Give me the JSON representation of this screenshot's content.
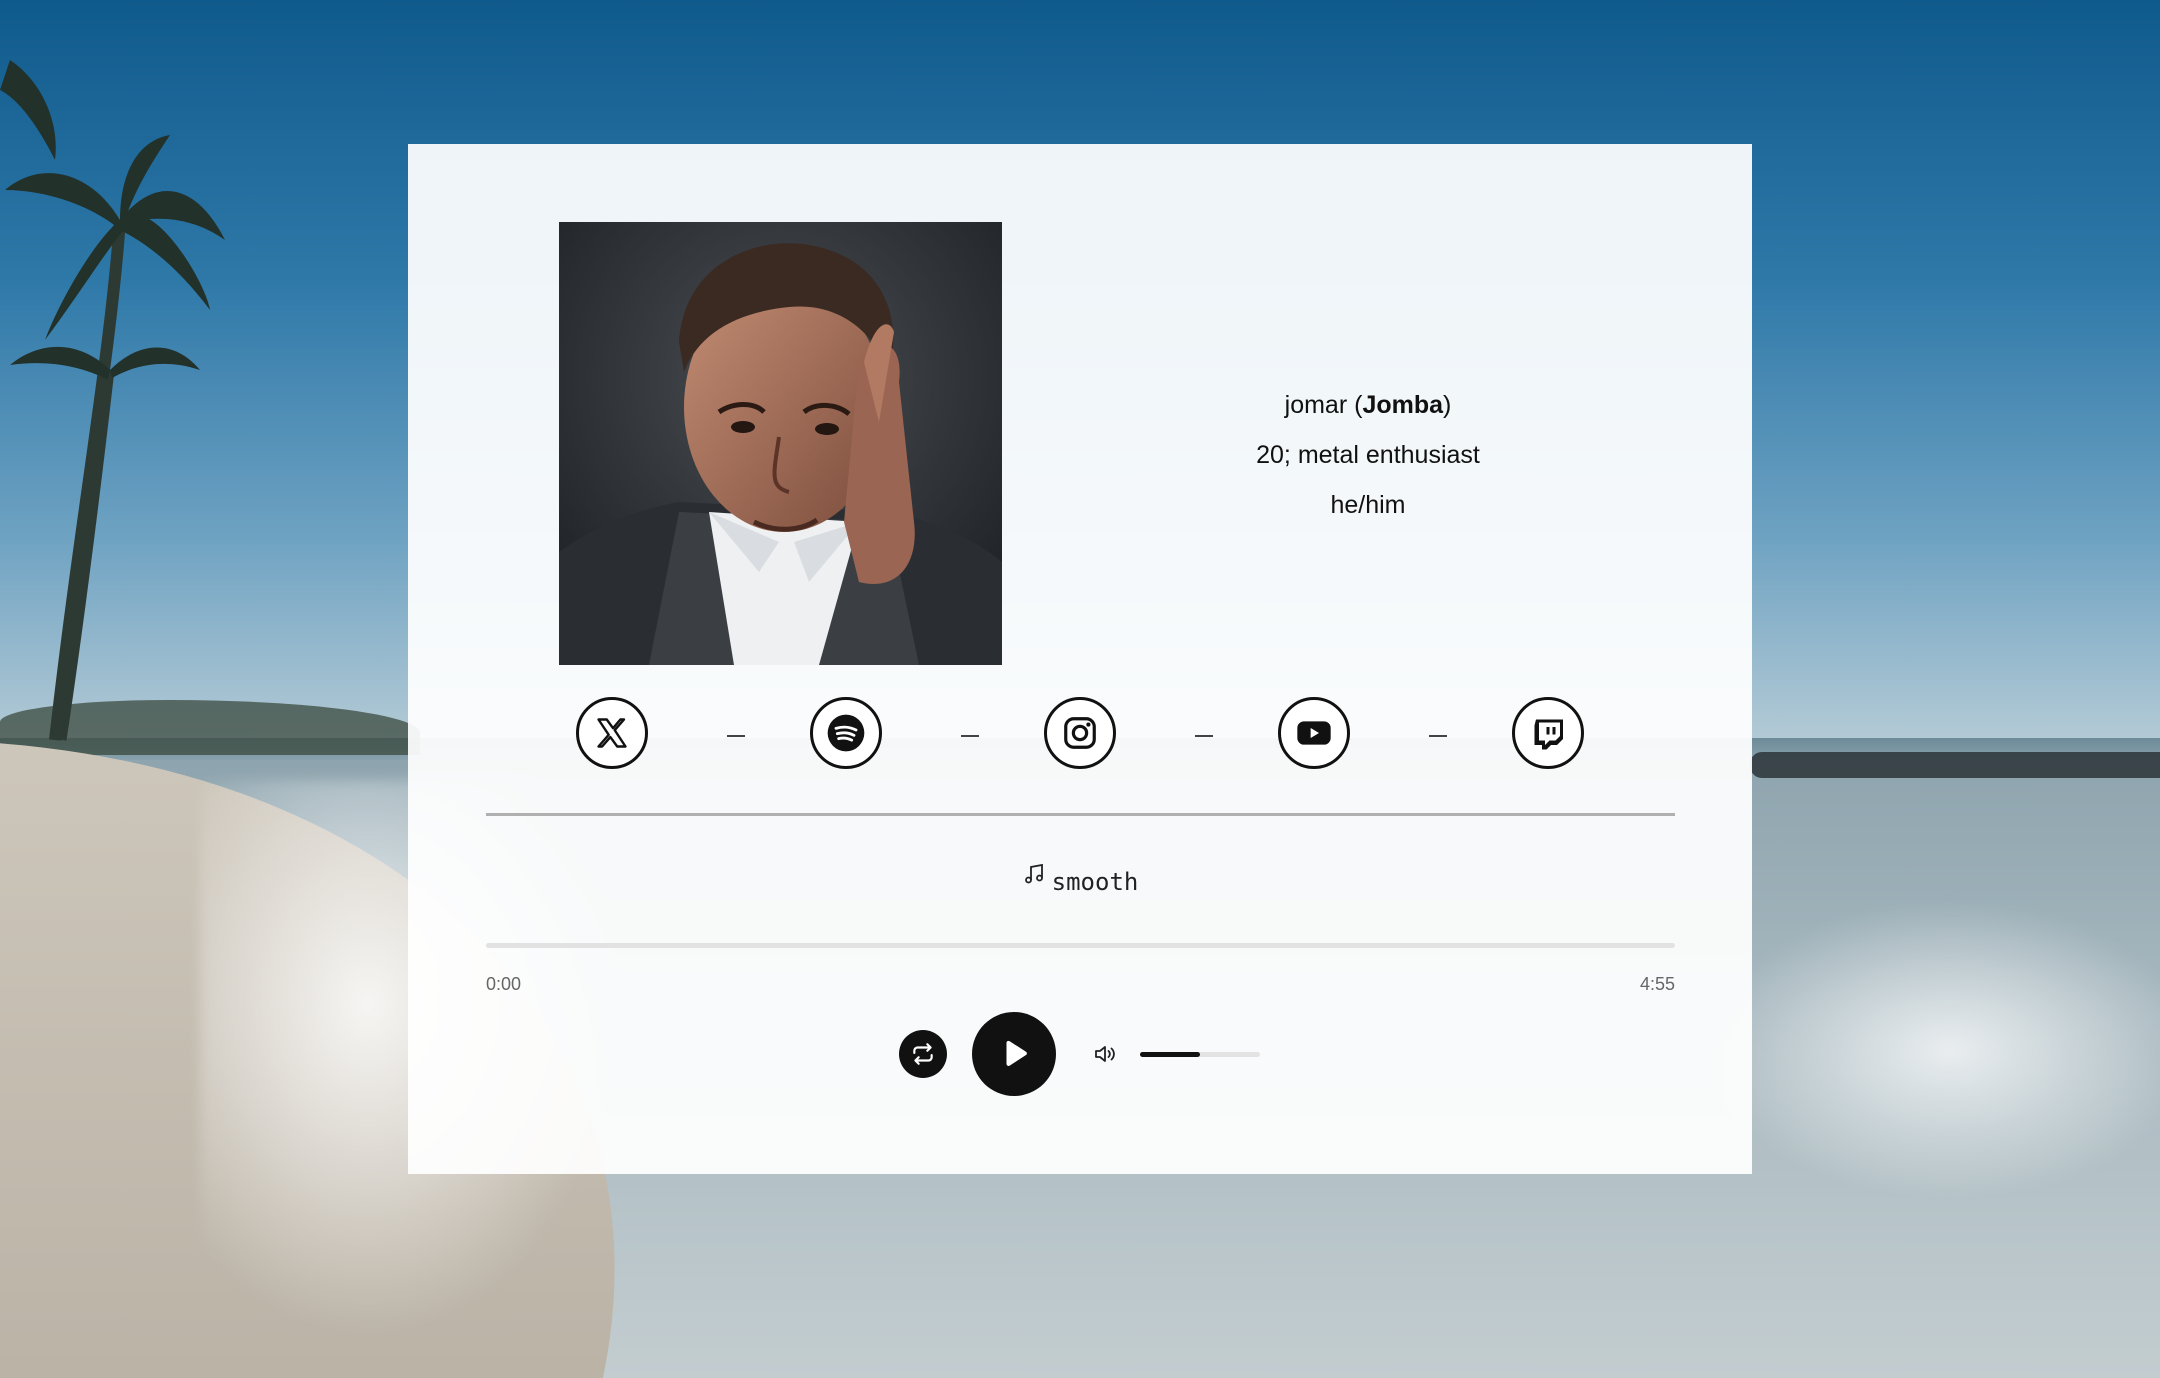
{
  "profile": {
    "name_prefix": "jomar (",
    "name_alias": "Jomba",
    "name_suffix": ")",
    "bio": "20; metal enthusiast",
    "pronouns": "he/him"
  },
  "socials": [
    {
      "name": "x-icon"
    },
    {
      "name": "spotify-icon"
    },
    {
      "name": "instagram-icon"
    },
    {
      "name": "youtube-icon"
    },
    {
      "name": "twitch-icon"
    }
  ],
  "player": {
    "track_title": "smooth",
    "current_time": "0:00",
    "duration": "4:55",
    "progress": 0,
    "volume": 0.5
  }
}
